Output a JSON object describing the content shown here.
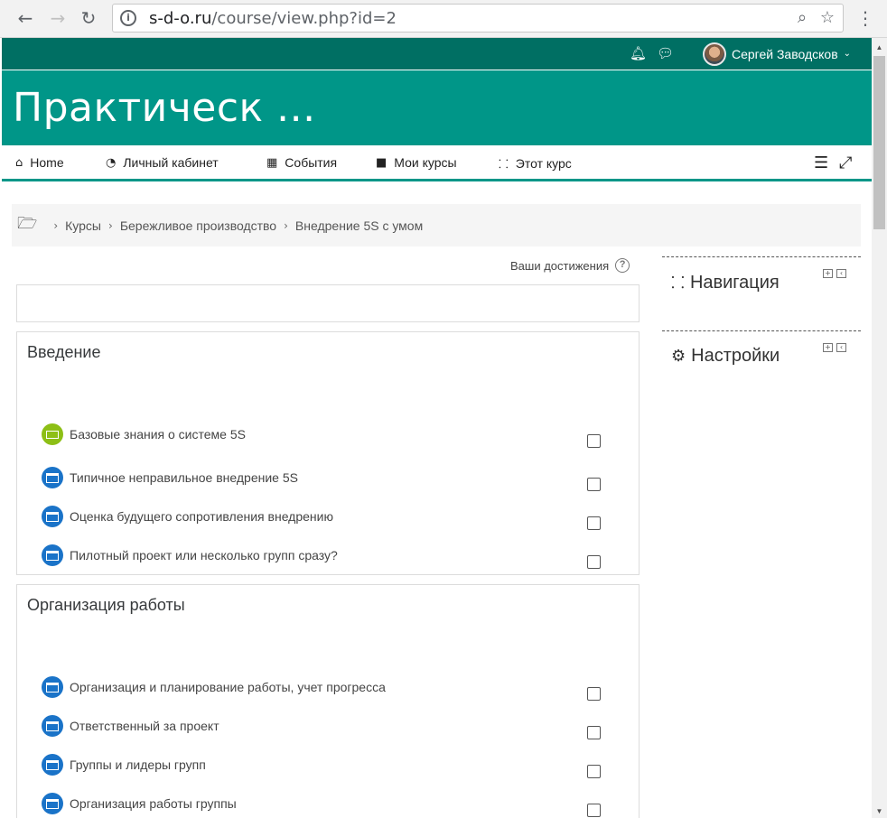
{
  "browser": {
    "back_icon": "arrow-left-icon",
    "forward_icon": "arrow-right-icon",
    "reload_icon": "reload-icon",
    "url_host": "s-d-o.ru",
    "url_path": "/course/view.php?id=2"
  },
  "topbar": {
    "user_name": "Сергей Заводсков"
  },
  "header": {
    "title": "Практическ ..."
  },
  "nav": {
    "items": [
      {
        "label": "Home",
        "icon": "home-icon"
      },
      {
        "label": "Личный кабинет",
        "icon": "dashboard-icon"
      },
      {
        "label": "События",
        "icon": "calendar-icon"
      },
      {
        "label": "Мои курсы",
        "icon": "briefcase-icon"
      },
      {
        "label": "Этот курс",
        "icon": "sitemap-icon"
      }
    ]
  },
  "breadcrumb": {
    "items": [
      "Курсы",
      "Бережливое производство",
      "Внедрение 5S с умом"
    ]
  },
  "achievements_label": "Ваши достижения",
  "sections": [
    {
      "title": "Введение",
      "activities": [
        {
          "label": "Базовые знания о системе 5S",
          "type": "presentation"
        },
        {
          "label": "Типичное неправильное внедрение 5S",
          "type": "page"
        },
        {
          "label": "Оценка будущего сопротивления внедрению",
          "type": "page"
        },
        {
          "label": "Пилотный проект или несколько групп сразу?",
          "type": "page"
        }
      ]
    },
    {
      "title": "Организация работы",
      "activities": [
        {
          "label": "Организация и планирование работы, учет прогресса",
          "type": "page"
        },
        {
          "label": "Ответственный за проект",
          "type": "page"
        },
        {
          "label": "Группы и лидеры групп",
          "type": "page"
        },
        {
          "label": "Организация работы группы",
          "type": "page"
        }
      ]
    }
  ],
  "blocks": [
    {
      "title": "Навигация",
      "icon": "sitemap-icon"
    },
    {
      "title": "Настройки",
      "icon": "cogs-icon"
    }
  ],
  "colors": {
    "topbar": "#006f63",
    "header": "#009688",
    "page_icon": "#1a73c8",
    "presentation_icon": "#8dbf16"
  }
}
